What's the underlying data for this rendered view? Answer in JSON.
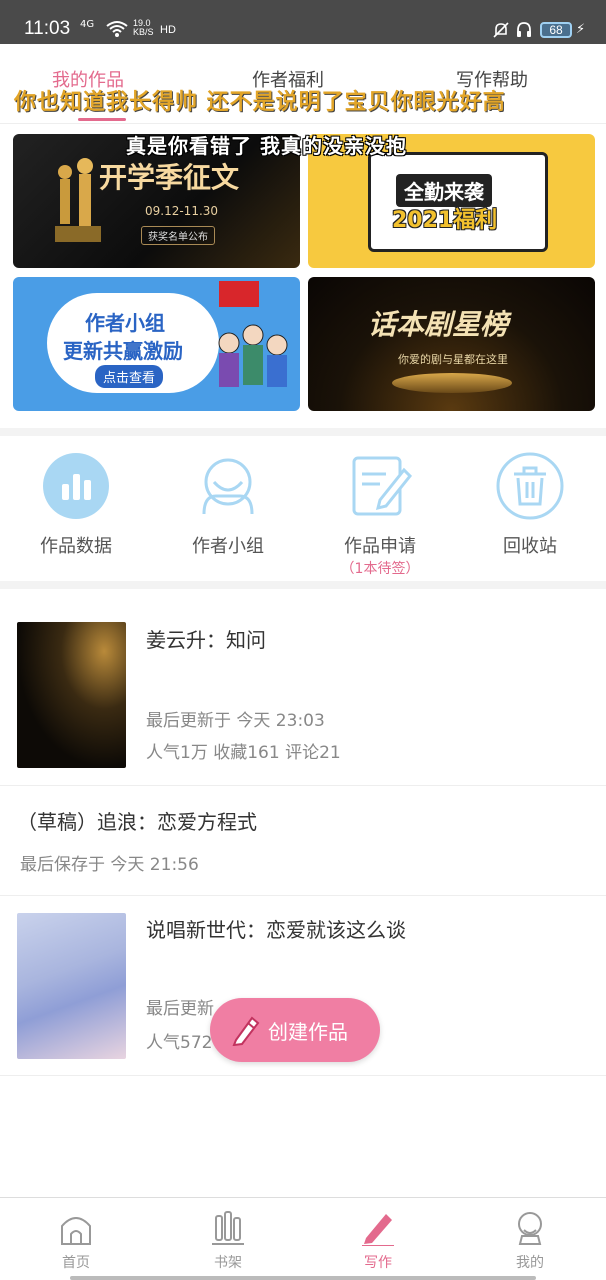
{
  "status_bar": {
    "time": "11:03",
    "network": "4G",
    "speed_value": "19.0",
    "speed_unit": "KB/S",
    "hd": "HD",
    "battery": "68"
  },
  "tabs": [
    {
      "label": "我的作品",
      "active": true
    },
    {
      "label": "作者福利",
      "active": false
    },
    {
      "label": "写作帮助",
      "active": false
    }
  ],
  "overlay_text": {
    "line1": "你也知道我长得帅 还不是说明了宝贝你眼光好高",
    "line2": "真是你看错了 我真的没亲没抱"
  },
  "banners": {
    "b1": {
      "title": "开学季征文",
      "date": "09.12-11.30",
      "note": "获奖名单公布"
    },
    "b2": {
      "line1": "全勤来袭",
      "line2": "2021福利"
    },
    "b3": {
      "line1": "作者小组",
      "line2": "更新共赢激励",
      "button": "点击查看"
    },
    "b4": {
      "title": "话本剧星榜",
      "subtitle": "你爱的剧与星都在这里"
    }
  },
  "tools": [
    {
      "label": "作品数据",
      "icon": "chart-icon",
      "sub": ""
    },
    {
      "label": "作者小组",
      "icon": "group-icon",
      "sub": ""
    },
    {
      "label": "作品申请",
      "icon": "edit-icon",
      "sub": "（1本待签）"
    },
    {
      "label": "回收站",
      "icon": "trash-icon",
      "sub": ""
    }
  ],
  "works": [
    {
      "title": "姜云升：知问",
      "updated": "最后更新于 今天 23:03",
      "stats": "人气1万 收藏161 评论21"
    },
    {
      "title": "（草稿）追浪：恋爱方程式",
      "updated": "最后保存于 今天 21:56",
      "stats": ""
    },
    {
      "title": "说唱新世代：恋爱就该这么谈",
      "updated": "最后更新",
      "stats": "人气572"
    }
  ],
  "fab": {
    "label": "创建作品"
  },
  "bottom_nav": [
    {
      "label": "首页",
      "icon": "home-icon",
      "active": false
    },
    {
      "label": "书架",
      "icon": "bookshelf-icon",
      "active": false
    },
    {
      "label": "写作",
      "icon": "pencil-icon",
      "active": true
    },
    {
      "label": "我的",
      "icon": "profile-icon",
      "active": false
    }
  ],
  "colors": {
    "accent": "#e36a8d",
    "fab": "#f07ea3",
    "icon_blue": "#6cbbe6",
    "status_bar": "#4a4a4a"
  }
}
